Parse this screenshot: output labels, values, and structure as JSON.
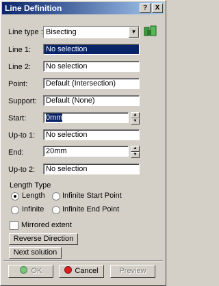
{
  "window": {
    "title": "Line Definition",
    "help_button": "?",
    "close_button": "X"
  },
  "line_type": {
    "label": "Line type :",
    "value": "Bisecting"
  },
  "fields": {
    "line1": {
      "label": "Line 1:",
      "value": "No selection"
    },
    "line2": {
      "label": "Line 2:",
      "value": "No selection"
    },
    "point": {
      "label": "Point:",
      "value": "Default (Intersection)"
    },
    "support": {
      "label": "Support:",
      "value": "Default (None)"
    },
    "start": {
      "label": "Start:",
      "value": "0mm"
    },
    "upto1": {
      "label": "Up-to 1:",
      "value": "No selection"
    },
    "end": {
      "label": "End:",
      "value": "20mm"
    },
    "upto2": {
      "label": "Up-to 2:",
      "value": "No selection"
    }
  },
  "length_type": {
    "label": "Length Type",
    "options": [
      "Length",
      "Infinite Start Point",
      "Infinite",
      "Infinite End Point"
    ],
    "selected": "Length"
  },
  "mirrored": {
    "label": "Mirrored extent",
    "checked": false
  },
  "buttons": {
    "reverse": "Reverse Direction",
    "next": "Next solution",
    "ok": "OK",
    "cancel": "Cancel",
    "preview": "Preview"
  },
  "colors": {
    "title_bar": "#0a246a",
    "selection": "#0a246a",
    "face": "#d4d0c8"
  }
}
